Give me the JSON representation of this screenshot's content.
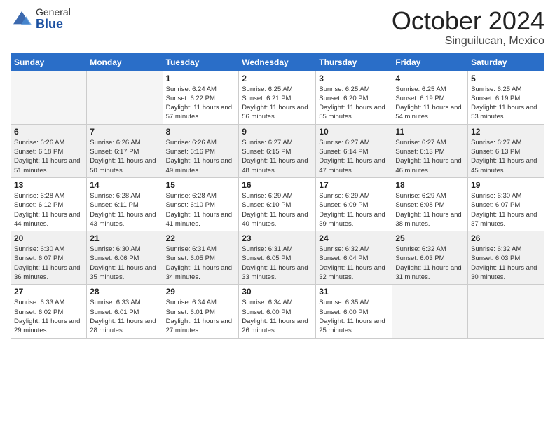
{
  "header": {
    "logo_general": "General",
    "logo_blue": "Blue",
    "month_title": "October 2024",
    "location": "Singuilucan, Mexico"
  },
  "days_of_week": [
    "Sunday",
    "Monday",
    "Tuesday",
    "Wednesday",
    "Thursday",
    "Friday",
    "Saturday"
  ],
  "weeks": [
    {
      "shaded": false,
      "days": [
        {
          "num": "",
          "empty": true,
          "info": ""
        },
        {
          "num": "",
          "empty": true,
          "info": ""
        },
        {
          "num": "1",
          "empty": false,
          "info": "Sunrise: 6:24 AM\nSunset: 6:22 PM\nDaylight: 11 hours and 57 minutes."
        },
        {
          "num": "2",
          "empty": false,
          "info": "Sunrise: 6:25 AM\nSunset: 6:21 PM\nDaylight: 11 hours and 56 minutes."
        },
        {
          "num": "3",
          "empty": false,
          "info": "Sunrise: 6:25 AM\nSunset: 6:20 PM\nDaylight: 11 hours and 55 minutes."
        },
        {
          "num": "4",
          "empty": false,
          "info": "Sunrise: 6:25 AM\nSunset: 6:19 PM\nDaylight: 11 hours and 54 minutes."
        },
        {
          "num": "5",
          "empty": false,
          "info": "Sunrise: 6:25 AM\nSunset: 6:19 PM\nDaylight: 11 hours and 53 minutes."
        }
      ]
    },
    {
      "shaded": true,
      "days": [
        {
          "num": "6",
          "empty": false,
          "info": "Sunrise: 6:26 AM\nSunset: 6:18 PM\nDaylight: 11 hours and 51 minutes."
        },
        {
          "num": "7",
          "empty": false,
          "info": "Sunrise: 6:26 AM\nSunset: 6:17 PM\nDaylight: 11 hours and 50 minutes."
        },
        {
          "num": "8",
          "empty": false,
          "info": "Sunrise: 6:26 AM\nSunset: 6:16 PM\nDaylight: 11 hours and 49 minutes."
        },
        {
          "num": "9",
          "empty": false,
          "info": "Sunrise: 6:27 AM\nSunset: 6:15 PM\nDaylight: 11 hours and 48 minutes."
        },
        {
          "num": "10",
          "empty": false,
          "info": "Sunrise: 6:27 AM\nSunset: 6:14 PM\nDaylight: 11 hours and 47 minutes."
        },
        {
          "num": "11",
          "empty": false,
          "info": "Sunrise: 6:27 AM\nSunset: 6:13 PM\nDaylight: 11 hours and 46 minutes."
        },
        {
          "num": "12",
          "empty": false,
          "info": "Sunrise: 6:27 AM\nSunset: 6:13 PM\nDaylight: 11 hours and 45 minutes."
        }
      ]
    },
    {
      "shaded": false,
      "days": [
        {
          "num": "13",
          "empty": false,
          "info": "Sunrise: 6:28 AM\nSunset: 6:12 PM\nDaylight: 11 hours and 44 minutes."
        },
        {
          "num": "14",
          "empty": false,
          "info": "Sunrise: 6:28 AM\nSunset: 6:11 PM\nDaylight: 11 hours and 43 minutes."
        },
        {
          "num": "15",
          "empty": false,
          "info": "Sunrise: 6:28 AM\nSunset: 6:10 PM\nDaylight: 11 hours and 41 minutes."
        },
        {
          "num": "16",
          "empty": false,
          "info": "Sunrise: 6:29 AM\nSunset: 6:10 PM\nDaylight: 11 hours and 40 minutes."
        },
        {
          "num": "17",
          "empty": false,
          "info": "Sunrise: 6:29 AM\nSunset: 6:09 PM\nDaylight: 11 hours and 39 minutes."
        },
        {
          "num": "18",
          "empty": false,
          "info": "Sunrise: 6:29 AM\nSunset: 6:08 PM\nDaylight: 11 hours and 38 minutes."
        },
        {
          "num": "19",
          "empty": false,
          "info": "Sunrise: 6:30 AM\nSunset: 6:07 PM\nDaylight: 11 hours and 37 minutes."
        }
      ]
    },
    {
      "shaded": true,
      "days": [
        {
          "num": "20",
          "empty": false,
          "info": "Sunrise: 6:30 AM\nSunset: 6:07 PM\nDaylight: 11 hours and 36 minutes."
        },
        {
          "num": "21",
          "empty": false,
          "info": "Sunrise: 6:30 AM\nSunset: 6:06 PM\nDaylight: 11 hours and 35 minutes."
        },
        {
          "num": "22",
          "empty": false,
          "info": "Sunrise: 6:31 AM\nSunset: 6:05 PM\nDaylight: 11 hours and 34 minutes."
        },
        {
          "num": "23",
          "empty": false,
          "info": "Sunrise: 6:31 AM\nSunset: 6:05 PM\nDaylight: 11 hours and 33 minutes."
        },
        {
          "num": "24",
          "empty": false,
          "info": "Sunrise: 6:32 AM\nSunset: 6:04 PM\nDaylight: 11 hours and 32 minutes."
        },
        {
          "num": "25",
          "empty": false,
          "info": "Sunrise: 6:32 AM\nSunset: 6:03 PM\nDaylight: 11 hours and 31 minutes."
        },
        {
          "num": "26",
          "empty": false,
          "info": "Sunrise: 6:32 AM\nSunset: 6:03 PM\nDaylight: 11 hours and 30 minutes."
        }
      ]
    },
    {
      "shaded": false,
      "days": [
        {
          "num": "27",
          "empty": false,
          "info": "Sunrise: 6:33 AM\nSunset: 6:02 PM\nDaylight: 11 hours and 29 minutes."
        },
        {
          "num": "28",
          "empty": false,
          "info": "Sunrise: 6:33 AM\nSunset: 6:01 PM\nDaylight: 11 hours and 28 minutes."
        },
        {
          "num": "29",
          "empty": false,
          "info": "Sunrise: 6:34 AM\nSunset: 6:01 PM\nDaylight: 11 hours and 27 minutes."
        },
        {
          "num": "30",
          "empty": false,
          "info": "Sunrise: 6:34 AM\nSunset: 6:00 PM\nDaylight: 11 hours and 26 minutes."
        },
        {
          "num": "31",
          "empty": false,
          "info": "Sunrise: 6:35 AM\nSunset: 6:00 PM\nDaylight: 11 hours and 25 minutes."
        },
        {
          "num": "",
          "empty": true,
          "info": ""
        },
        {
          "num": "",
          "empty": true,
          "info": ""
        }
      ]
    }
  ]
}
